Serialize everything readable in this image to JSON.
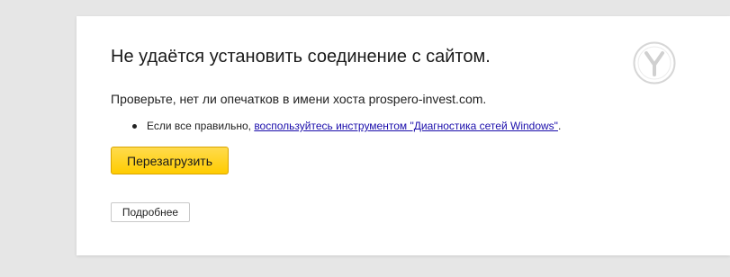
{
  "error": {
    "title": "Не удаётся установить соединение с сайтом.",
    "description": "Проверьте, нет ли опечатков в имени хоста prospero-invest.com.",
    "hint": {
      "text": "Если все правильно, ",
      "link_label": "воспользуйтесь инструментом \"Диагностика сетей Windows\"",
      "suffix": "."
    }
  },
  "buttons": {
    "reload_label": "Перезагрузить",
    "details_label": "Подробнее"
  },
  "logo": {
    "icon": "yandex-browser-logo-icon"
  },
  "colors": {
    "reload_button": "#ffcc00",
    "link": "#1a0dab"
  }
}
